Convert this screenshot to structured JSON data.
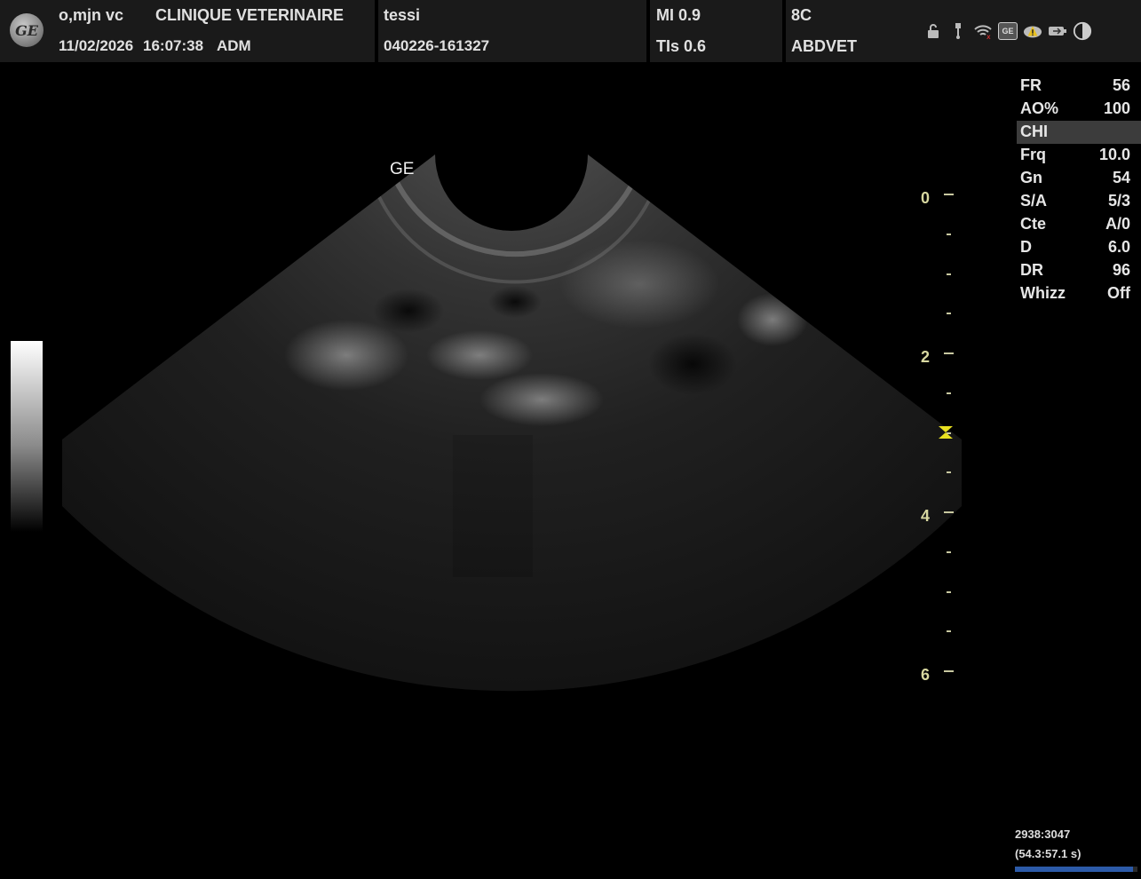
{
  "header": {
    "patient_name": "o,mjn vc",
    "clinic": "CLINIQUE VETERINAIRE",
    "date": "11/02/2026",
    "time": "16:07:38",
    "operator": "ADM",
    "patient_id_name": "tessi",
    "exam_id": "040226-161327",
    "mi": "MI 0.9",
    "tis": "TIs 0.6",
    "probe": "8C",
    "preset": "ABDVET"
  },
  "status_icons": [
    "lock-icon",
    "usb-icon",
    "wifi-icon",
    "ge-service-icon",
    "warning-icon",
    "battery-icon",
    "contrast-icon"
  ],
  "image": {
    "watermark": "GE"
  },
  "params": [
    {
      "key": "FR",
      "value": "56",
      "highlight": false
    },
    {
      "key": "AO%",
      "value": "100",
      "highlight": false
    },
    {
      "key": "CHI",
      "value": "",
      "highlight": true
    },
    {
      "key": "Frq",
      "value": "10.0",
      "highlight": false
    },
    {
      "key": "Gn",
      "value": "54",
      "highlight": false
    },
    {
      "key": "S/A",
      "value": "5/3",
      "highlight": false
    },
    {
      "key": "Cte",
      "value": "A/0",
      "highlight": false
    },
    {
      "key": "D",
      "value": "6.0",
      "highlight": false
    },
    {
      "key": "DR",
      "value": "96",
      "highlight": false
    },
    {
      "key": "Whizz",
      "value": "Off",
      "highlight": false
    }
  ],
  "depth_scale": {
    "labels": [
      "0",
      "2",
      "4",
      "6"
    ],
    "max_cm": 6.0,
    "focus_cm": 3.0
  },
  "cine": {
    "frames": "2938:3047",
    "time": "(54.3:57.1 s)",
    "progress": 0.964
  },
  "colors": {
    "background": "#000000",
    "topbar": "#1a1a1a",
    "scale_tick": "#c8c8a0",
    "focus_marker": "#e8e020",
    "progress": "#2c5aa8"
  }
}
